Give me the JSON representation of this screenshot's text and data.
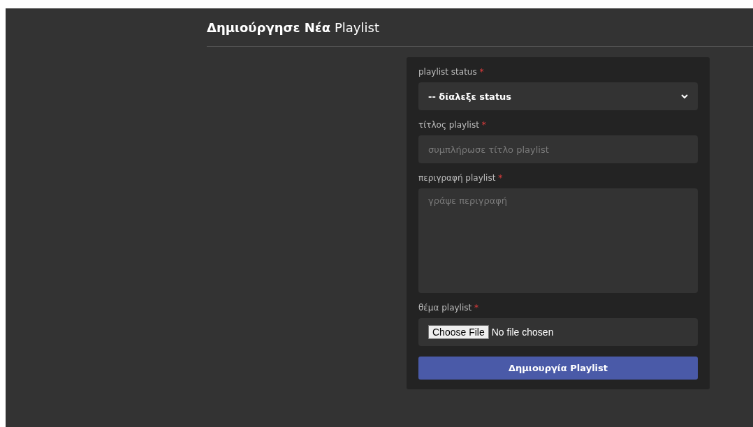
{
  "heading": "**Δημιούργησε Νέα** Playlist",
  "form": {
    "fields": [
      {
        "kind": "select",
        "label": "playlist status",
        "mark": "*",
        "value": "-- δίαλεξε status"
      },
      {
        "kind": "input",
        "label": "τίτλος playlist",
        "mark": "*",
        "placeholder": "συμπλήρωσε τίτλο playlist"
      },
      {
        "kind": "textarea",
        "label": "περιγραφή playlist",
        "mark": "*",
        "placeholder": "γράψε περιγραφή"
      },
      {
        "kind": "file",
        "label": "θέμα playlist",
        "mark": "*",
        "button": "Choose File",
        "status": "No file chosen"
      }
    ],
    "submit": "Δημιουργία Playlist"
  }
}
